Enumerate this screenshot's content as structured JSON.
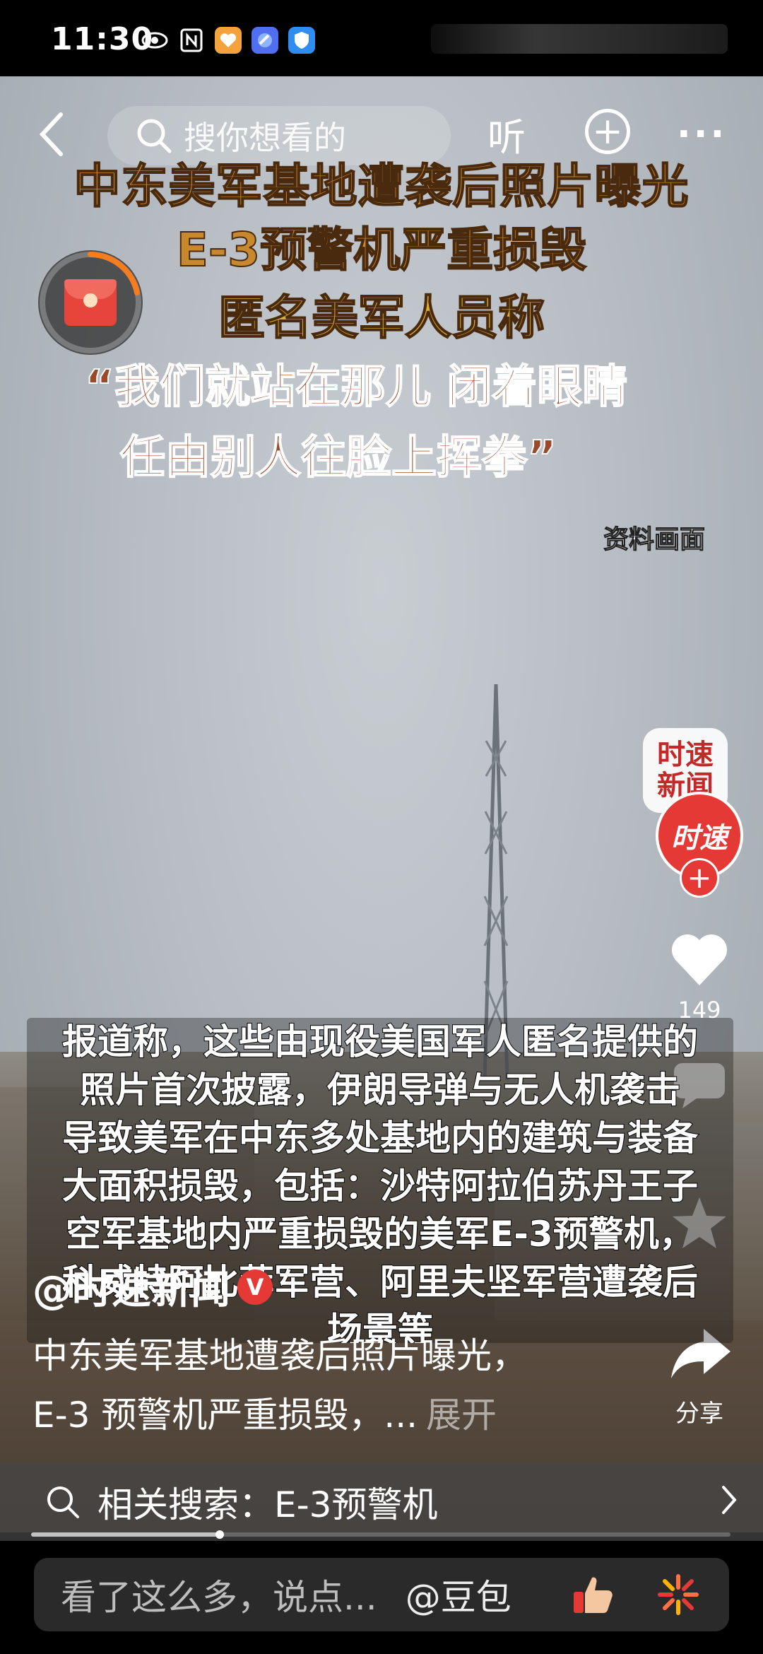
{
  "status_bar": {
    "time": "11:30",
    "icons": [
      "eye-icon",
      "nfc-icon",
      "app-heart-icon",
      "app-blue-icon",
      "shield-app-icon"
    ]
  },
  "top_nav": {
    "search_placeholder": "搜你想看的",
    "listen_label": "听"
  },
  "video": {
    "headline": {
      "line1": "中东美军基地遭袭后照片曝光",
      "line2": "E-3预警机严重损毁",
      "line3": "匿名美军人员称",
      "line4": "“我们就站在那儿 闭着眼睛",
      "line5": "任由别人往脸上挥拳”"
    },
    "source_label": "资料画面",
    "subtitle_lines": [
      "报道称，这些由现役美国军人匿名提供的",
      "照片首次披露，伊朗导弹与无人机袭击",
      "导致美军在中东多处基地内的建筑与装备",
      "大面积损毁，包括：沙特阿拉伯苏丹王子",
      "空军基地内严重损毁的美军E-3预警机，",
      "科威特阿比菲军营、阿里夫坚军营遭袭后",
      "场景等"
    ],
    "progress": 0.27
  },
  "side_actions": {
    "logo_text": "时速\n新闻",
    "badge_text": "时速",
    "like_count": "149",
    "share_label": "分享"
  },
  "post": {
    "author": "@时速新闻",
    "verified": "V",
    "desc_line1": "中东美军基地遭袭后照片曝光，",
    "desc_line2": "E-3 预警机严重损毁，...",
    "expand_label": "展开"
  },
  "related_search": {
    "text": "相关搜索：E-3预警机"
  },
  "comment_bar": {
    "placeholder": "看了这么多，说点...",
    "mention": "@豆包",
    "colors": {
      "accent": "#e53935"
    }
  }
}
